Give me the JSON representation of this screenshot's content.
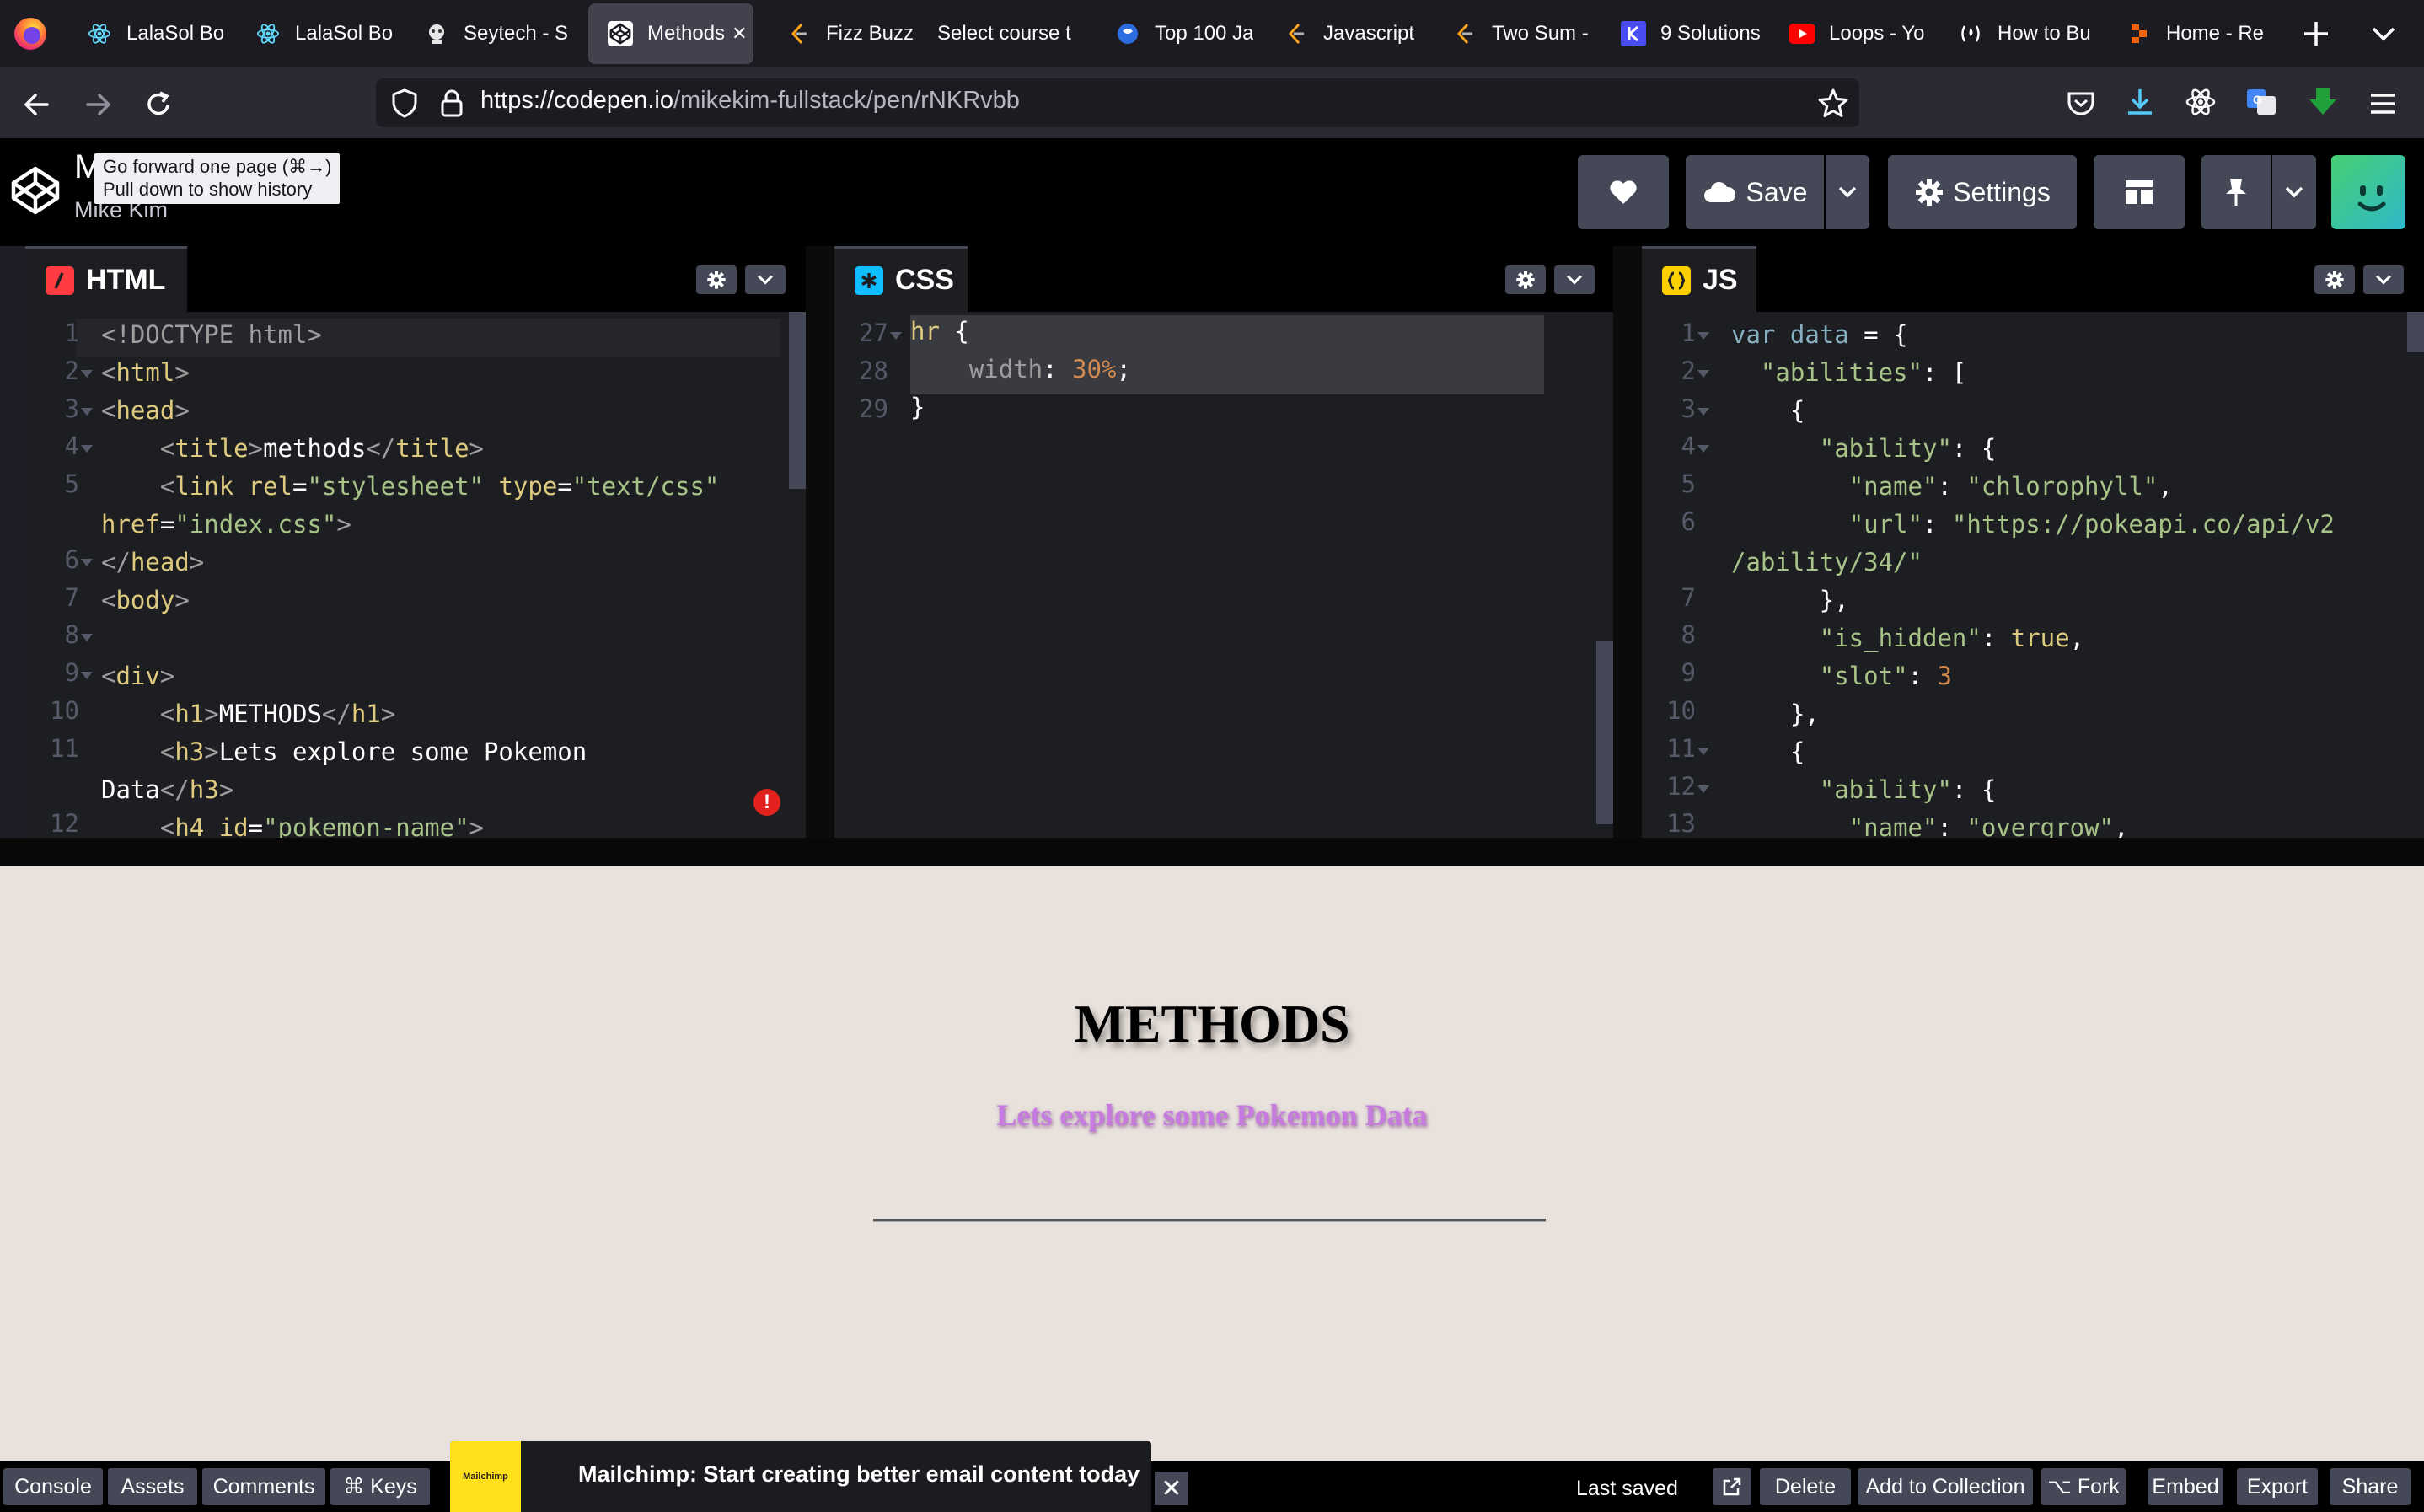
{
  "browser": {
    "tabs": [
      {
        "title": "LalaSol Bo",
        "icon": "react-icon"
      },
      {
        "title": "LalaSol Bo",
        "icon": "react-icon"
      },
      {
        "title": "Seytech - S",
        "icon": "seytech-icon"
      },
      {
        "title": "Methods",
        "icon": "codepen-icon",
        "active": true
      },
      {
        "title": "Fizz Buzz -",
        "icon": "leetcode-icon"
      },
      {
        "title": "Select course t",
        "icon": "none"
      },
      {
        "title": "Top 100 Ja",
        "icon": "globe-icon"
      },
      {
        "title": "Javascript",
        "icon": "leetcode-icon"
      },
      {
        "title": "Two Sum -",
        "icon": "leetcode-icon"
      },
      {
        "title": "9 Solutions",
        "icon": "k-icon"
      },
      {
        "title": "Loops - Yo",
        "icon": "youtube-icon"
      },
      {
        "title": "How to Bu",
        "icon": "freecodecamp-icon"
      },
      {
        "title": "Home - Re",
        "icon": "replit-icon"
      }
    ],
    "close_tab_glyph": "✕",
    "url_host": "https://codepen.io",
    "url_path": "/mikekim-fullstack/pen/rNKRvbb"
  },
  "codepen": {
    "title_initial": "M",
    "author": "Mike Kim",
    "tooltip_line1": "Go forward one page (⌘→)",
    "tooltip_line2": "Pull down to show history",
    "save_label": "Save",
    "settings_label": "Settings"
  },
  "editors": {
    "html": {
      "label": "HTML",
      "color": "#ff3c41",
      "gutter": [
        "1",
        "2",
        "3",
        "4",
        "5",
        "",
        "6",
        "7",
        "8",
        "9",
        "10",
        "11",
        "",
        "12"
      ],
      "fold_rows": [
        1,
        2,
        3,
        6,
        8,
        9
      ]
    },
    "css": {
      "label": "CSS",
      "color": "#0ebeff",
      "gutter": [
        "27",
        "28",
        "29"
      ],
      "fold_rows": [
        0
      ]
    },
    "js": {
      "label": "JS",
      "color": "#fcd000",
      "gutter": [
        "1",
        "2",
        "3",
        "4",
        "5",
        "6",
        "",
        "7",
        "8",
        "9",
        "10",
        "11",
        "12",
        "13"
      ],
      "fold_rows": [
        0,
        1,
        2,
        3,
        11,
        12
      ]
    }
  },
  "preview": {
    "h1": "METHODS",
    "h3": "Lets explore some Pokemon Data"
  },
  "footer": {
    "console": "Console",
    "assets": "Assets",
    "comments": "Comments",
    "keys": "⌘ Keys",
    "ad_text": "Mailchimp: Start creating better email content today",
    "ad_logo": "Mailchimp",
    "ad_close": "✕",
    "last_saved": "Last saved",
    "delete": "Delete",
    "add_to_collection": "Add to Collection",
    "fork": "⌥ Fork",
    "embed": "Embed",
    "export": "Export",
    "share": "Share"
  }
}
